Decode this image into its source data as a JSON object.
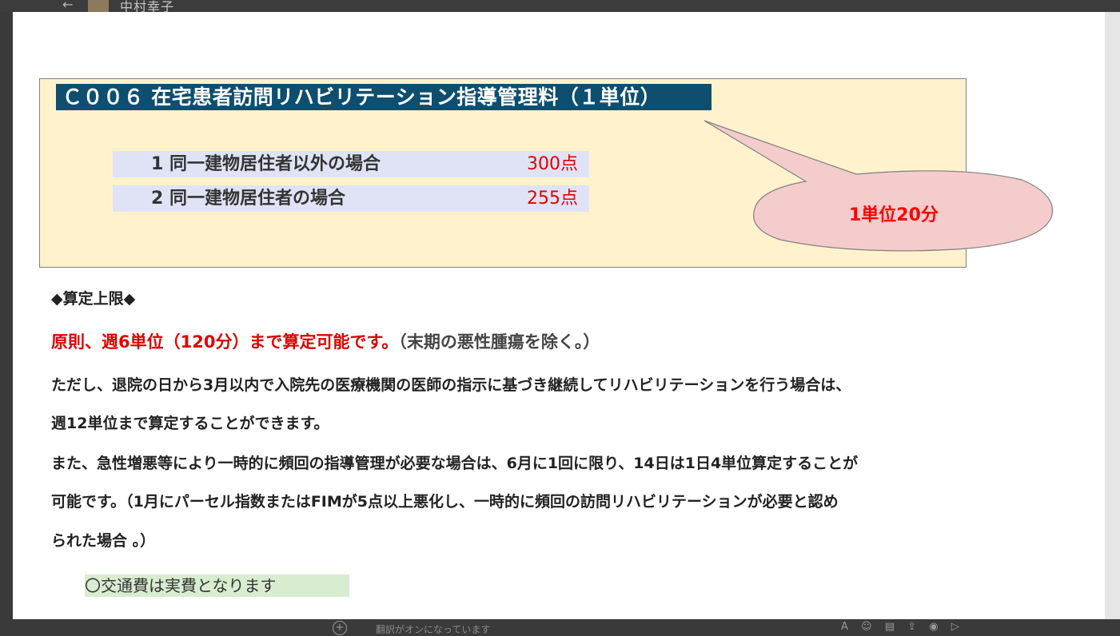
{
  "app": {
    "back_label": "←",
    "contact_name": "中村幸子",
    "compose_hint": "翻訳がオンになっています",
    "toolbar_icons": [
      "format-icon",
      "emoji-icon",
      "sticker-icon",
      "upload-icon",
      "record-icon",
      "send-icon"
    ]
  },
  "slide": {
    "title": "Ｃ００６ 在宅患者訪問リハビリテーション指導管理料（１単位）",
    "items": [
      {
        "label": "1  同一建物居住者以外の場合",
        "points": "300点"
      },
      {
        "label": "2  同一建物居住者の場合",
        "points": "255点"
      }
    ],
    "callout": "1単位20分",
    "limit_heading": "◆算定上限◆",
    "rule_red": "原則、週6単位（120分）まで算定可能です。",
    "rule_gray": "（末期の悪性腫瘍を除く。）",
    "lines": [
      "ただし、退院の日から3月以内で入院先の医療機関の医師の指示に基づき継続してリハビリテーションを行う場合は、",
      "週12単位まで算定することができます。",
      "また、急性増悪等により一時的に頻回の指導管理が必要な場合は、6月に1回に限り、14日は1日4単位算定することが",
      "可能です。（1月にパーセル指数またはFIMが5点以上悪化し、一時的に頻回の訪問リハビリテーションが必要と認め",
      "られた場合 。）"
    ],
    "note": "〇交通費は実費となります"
  },
  "colors": {
    "title_bg": "#0e4e6e",
    "box_bg": "#fff2cc",
    "item_bg": "#dfe3f5",
    "points": "#e00000",
    "callout_fill": "#f4cccc",
    "note_bg": "#d8ecd0"
  }
}
